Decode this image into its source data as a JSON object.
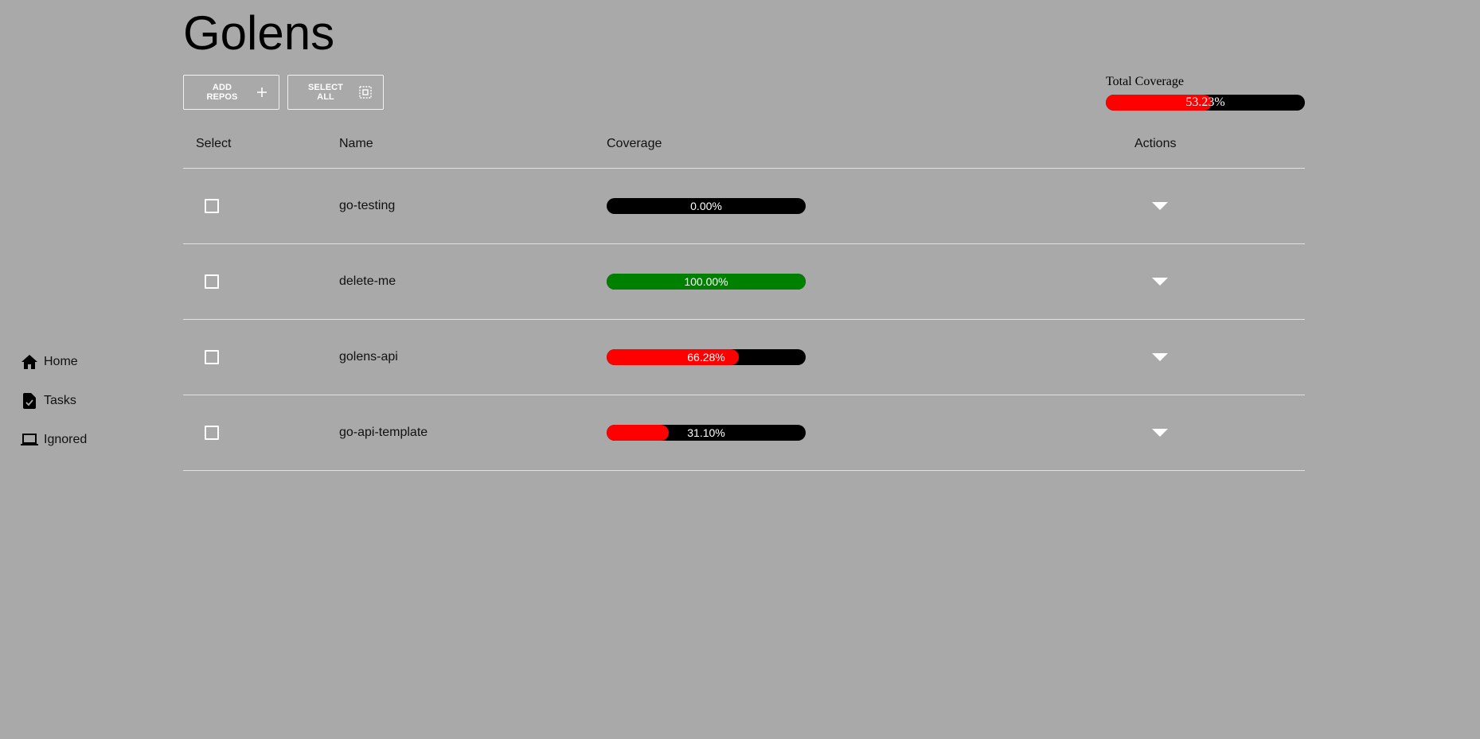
{
  "sidebar": {
    "items": [
      {
        "label": "Home",
        "icon": "home-icon"
      },
      {
        "label": "Tasks",
        "icon": "task-icon"
      },
      {
        "label": "Ignored",
        "icon": "laptop-icon"
      }
    ]
  },
  "header": {
    "title": "Golens"
  },
  "toolbar": {
    "add_label": "ADD REPOS",
    "add_icon": "plus-icon",
    "select_all_label": "SELECT ALL",
    "select_all_icon": "select-all-icon"
  },
  "total_coverage": {
    "label": "Total Coverage",
    "value": 53.23,
    "text": "53.23%"
  },
  "table": {
    "columns": [
      "Select",
      "Name",
      "Coverage",
      "Actions"
    ],
    "rows": [
      {
        "name": "go-testing",
        "coverage": 0.0,
        "coverage_text": "0.00%",
        "checked": false
      },
      {
        "name": "delete-me",
        "coverage": 100.0,
        "coverage_text": "100.00%",
        "checked": false
      },
      {
        "name": "golens-api",
        "coverage": 66.28,
        "coverage_text": "66.28%",
        "checked": false
      },
      {
        "name": "go-api-template",
        "coverage": 31.1,
        "coverage_text": "31.10%",
        "checked": false
      }
    ]
  },
  "colors": {
    "background": "#a9a9a9",
    "bar_track": "#000000",
    "bar_partial": "#ff0000",
    "bar_full": "#008000",
    "foreground_light": "#ffffff"
  }
}
